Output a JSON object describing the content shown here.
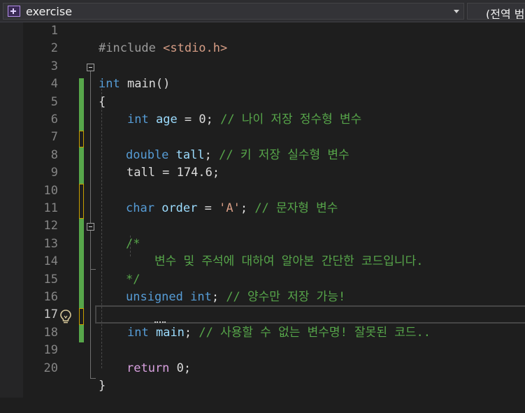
{
  "navbar": {
    "scope": "exercise",
    "member": "(전역 범위)",
    "scope_icon": "class-icon",
    "arrow_icon": "chevron-down-icon"
  },
  "editor": {
    "active_line": "17",
    "line_numbers": [
      "1",
      "2",
      "3",
      "4",
      "5",
      "6",
      "7",
      "8",
      "9",
      "10",
      "11",
      "12",
      "13",
      "14",
      "15",
      "16",
      "17",
      "18",
      "19",
      "20"
    ],
    "lines": {
      "l1": {
        "pp": "#include ",
        "str": "<stdio.h>"
      },
      "l3": {
        "kw": "int",
        "fn": " main()"
      },
      "l4": {
        "brace": "{"
      },
      "l5": {
        "kw": "int",
        "name": "age",
        "rest": " = 0; ",
        "cm": "// 나이 저장 정수형 변수"
      },
      "l7": {
        "kw": "double",
        "name": "tall",
        "rest": "; ",
        "cm": "// 키 저장 실수형 변수"
      },
      "l8": {
        "text": "tall = 174.6;"
      },
      "l10": {
        "kw": "char",
        "name": "order",
        "rest1": " = ",
        "str": "'A'",
        "rest2": "; ",
        "cm": "// 문자형 변수"
      },
      "l12": {
        "cm": "/*"
      },
      "l13": {
        "cm": "변수 및 주석에 대하여 알아본 간단한 코드입니다."
      },
      "l14": {
        "cm": "*/"
      },
      "l15": {
        "kw": "unsigned int",
        "rest": "; ",
        "cm": "// 양수만 저장 가능!"
      },
      "l17": {
        "kw": "int",
        "name": "main",
        "rest": "; ",
        "cm": "// 사용할 수 없는 변수명! 잘못된 코드.."
      },
      "l19": {
        "ctl": "return",
        "rest": " 0;"
      },
      "l20": {
        "brace": "}"
      }
    },
    "accent_colors": {
      "keyword": "#569cd6",
      "comment": "#57a64a",
      "string": "#d69d85",
      "change_bar": "#57a64a",
      "modified": "#c8a000"
    }
  }
}
